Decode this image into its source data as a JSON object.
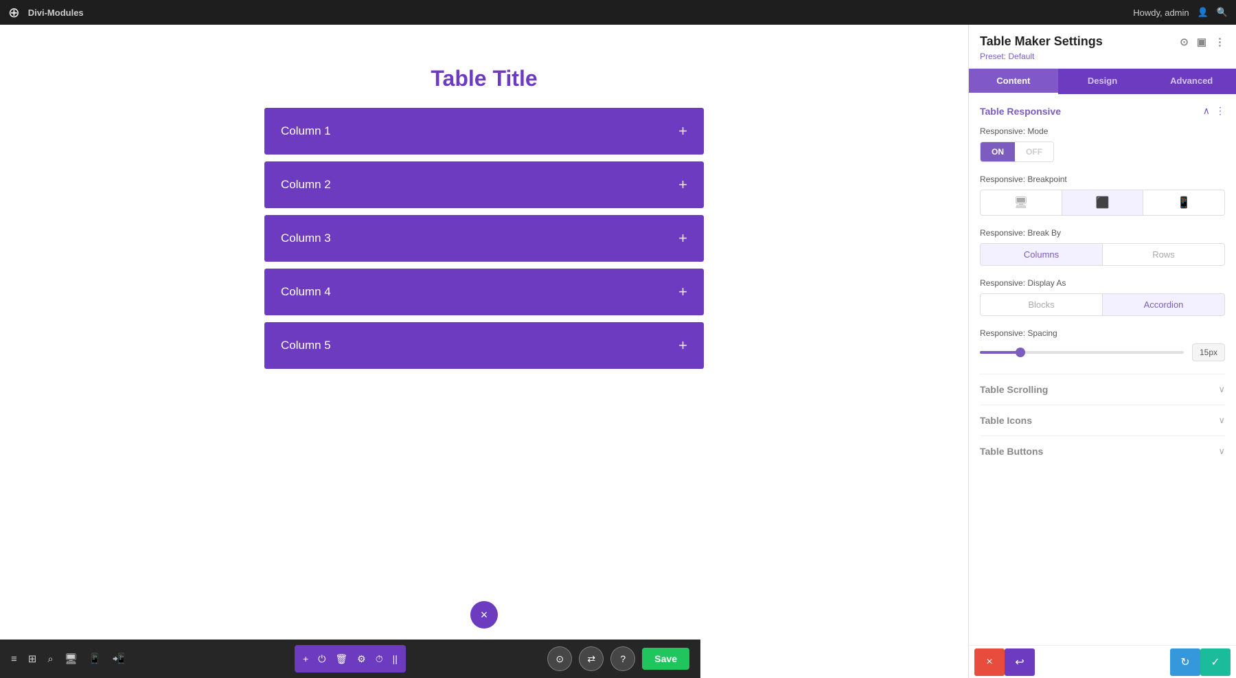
{
  "topbar": {
    "logo": "W",
    "site_name": "Divi-Modules",
    "greeting": "Howdy, admin",
    "search_icon": "🔍"
  },
  "canvas": {
    "title": "Table Title",
    "columns": [
      {
        "label": "Column 1"
      },
      {
        "label": "Column 2"
      },
      {
        "label": "Column 3"
      },
      {
        "label": "Column 4"
      },
      {
        "label": "Column 5"
      }
    ],
    "close_icon": "×",
    "toolbar_icons": [
      "+",
      "⏻",
      "🗑",
      "⚙",
      "⏱",
      "||"
    ],
    "save_label": "Save"
  },
  "settings": {
    "title": "Table Maker Settings",
    "preset": "Preset: Default",
    "tabs": [
      "Content",
      "Design",
      "Advanced"
    ],
    "active_tab": "Content",
    "sections": {
      "table_responsive": {
        "title": "Table Responsive",
        "responsive_mode": {
          "label": "Responsive: Mode",
          "on_label": "ON",
          "off_label": "OFF",
          "active": "on"
        },
        "responsive_breakpoint": {
          "label": "Responsive: Breakpoint",
          "options": [
            "desktop",
            "tablet",
            "phone"
          ],
          "active": "tablet"
        },
        "responsive_break_by": {
          "label": "Responsive: Break By",
          "options": [
            "Columns",
            "Rows"
          ],
          "active": "Columns"
        },
        "responsive_display_as": {
          "label": "Responsive: Display As",
          "options": [
            "Blocks",
            "Accordion"
          ],
          "active": "Accordion"
        },
        "responsive_spacing": {
          "label": "Responsive: Spacing",
          "value": "15px",
          "percent": 20
        }
      },
      "table_scrolling": {
        "title": "Table Scrolling",
        "collapsed": true
      },
      "table_icons": {
        "title": "Table Icons",
        "collapsed": true
      },
      "table_buttons": {
        "title": "Table Buttons",
        "collapsed": true
      }
    },
    "bottom_bar": {
      "close_icon": "×",
      "undo_icon": "↩",
      "redo_icon": "↻",
      "check_icon": "✓"
    }
  }
}
